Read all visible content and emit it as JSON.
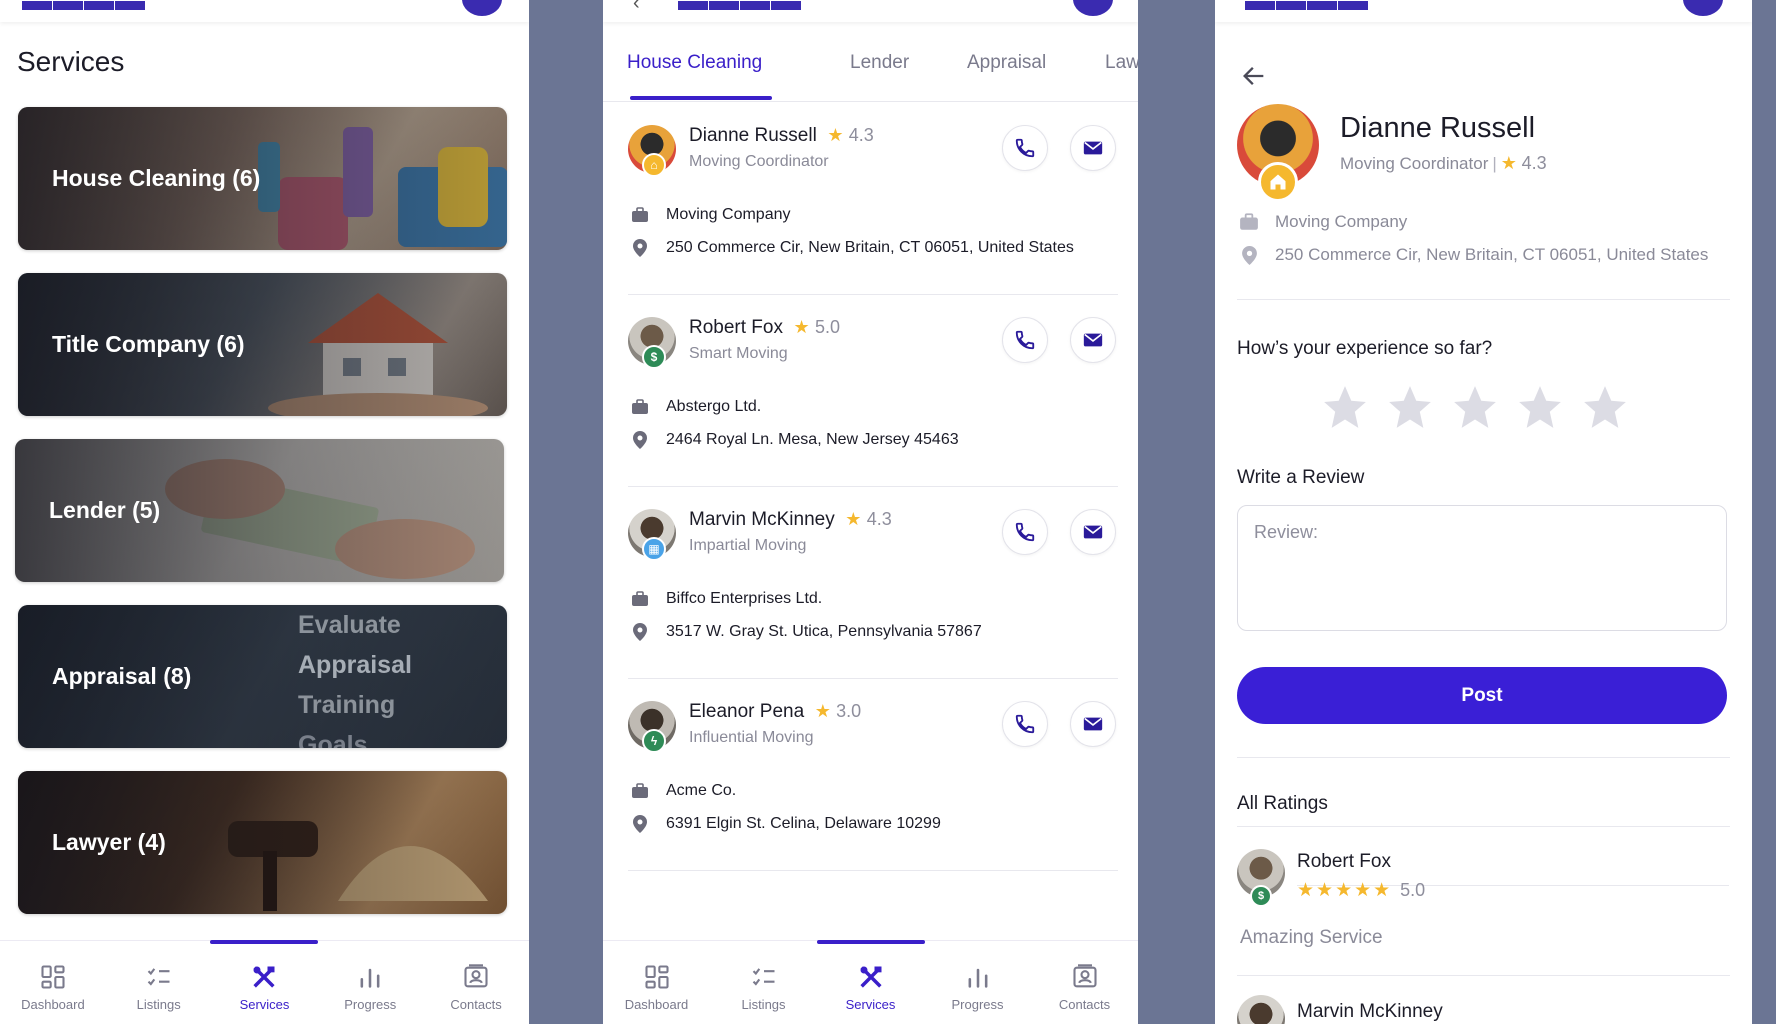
{
  "colors": {
    "primary": "#3a1fd6",
    "star": "#f5b82e",
    "background": "#6B7594",
    "text": "#1c1c28",
    "muted": "#8a8a98"
  },
  "services_screen": {
    "title": "Services",
    "cards": [
      {
        "label": "House Cleaning (6)"
      },
      {
        "label": "Title Company (6)"
      },
      {
        "label": "Lender (5)"
      },
      {
        "label": "Appraisal (8)",
        "overlay_words": [
          "Evaluate",
          "Appraisal",
          "Training",
          "Goals"
        ]
      },
      {
        "label": "Lawyer (4)"
      }
    ]
  },
  "list_screen": {
    "tabs": [
      "House Cleaning",
      "Lender",
      "Appraisal",
      "Law"
    ],
    "active_tab": "House Cleaning",
    "providers": [
      {
        "name": "Dianne Russell",
        "rating": "4.3",
        "role": "Moving Coordinator",
        "company": "Moving Company",
        "address": "250 Commerce Cir, New Britain, CT 06051, United States",
        "badge_icon": "home-icon",
        "badge_color": "#f5b82e"
      },
      {
        "name": "Robert Fox",
        "rating": "5.0",
        "role": "Smart Moving",
        "company": "Abstergo Ltd.",
        "address": "2464 Royal Ln. Mesa, New Jersey 45463",
        "badge_icon": "dollar-icon",
        "badge_color": "#2e8b57"
      },
      {
        "name": "Marvin McKinney",
        "rating": "4.3",
        "role": "Impartial Moving",
        "company": "Biffco Enterprises Ltd.",
        "address": "3517 W. Gray St. Utica, Pennsylvania 57867",
        "badge_icon": "calculator-icon",
        "badge_color": "#4aa3e8"
      },
      {
        "name": "Eleanor Pena",
        "rating": "3.0",
        "role": "Influential Moving",
        "company": "Acme Co.",
        "address": "6391 Elgin St. Celina, Delaware 10299",
        "badge_icon": "bolt-icon",
        "badge_color": "#2e8b57"
      }
    ]
  },
  "detail_screen": {
    "name": "Dianne Russell",
    "role": "Moving Coordinator",
    "separator": "|",
    "rating": "4.3",
    "company": "Moving Company",
    "address": "250 Commerce Cir, New Britain, CT 06051, United States",
    "experience_question": "How’s your experience so far?",
    "write_review_label": "Write a Review",
    "review_placeholder": "Review:",
    "review_value": "",
    "post_label": "Post",
    "all_ratings_label": "All Ratings",
    "reviews": [
      {
        "name": "Robert Fox",
        "stars": "★★★★★",
        "rating": "5.0",
        "text": "Amazing Service"
      },
      {
        "name": "Marvin McKinney"
      }
    ]
  },
  "bottom_nav": {
    "items": [
      {
        "label": "Dashboard",
        "icon": "dashboard-icon"
      },
      {
        "label": "Listings",
        "icon": "listings-icon"
      },
      {
        "label": "Services",
        "icon": "services-icon"
      },
      {
        "label": "Progress",
        "icon": "progress-icon"
      },
      {
        "label": "Contacts",
        "icon": "contacts-icon"
      }
    ],
    "active": "Services"
  }
}
